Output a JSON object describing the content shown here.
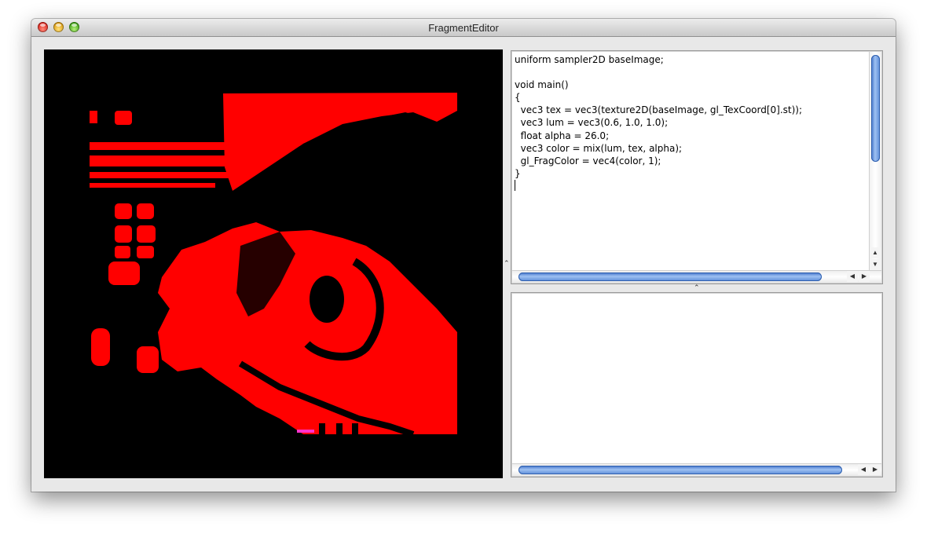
{
  "window": {
    "title": "FragmentEditor"
  },
  "preview": {
    "description_icon": "rendered-image-preview",
    "colors": {
      "background": "#000000",
      "tint": "#ff0000"
    }
  },
  "editor": {
    "code": "uniform sampler2D baseImage;\n\nvoid main()\n{\n  vec3 tex = vec3(texture2D(baseImage, gl_TexCoord[0].st));\n  vec3 lum = vec3(0.6, 1.0, 1.0);\n  float alpha = 26.0;\n  vec3 color = mix(lum, tex, alpha);\n  gl_FragColor = vec4(color, 1);\n}"
  },
  "output": {
    "text": ""
  },
  "icons": {
    "up": "▲",
    "down": "▼",
    "left": "◀",
    "right": "▶",
    "grip": "⌃"
  },
  "theme": {
    "scrollbar": "#5a8ad8",
    "window_bg": "#e8e8e8"
  }
}
